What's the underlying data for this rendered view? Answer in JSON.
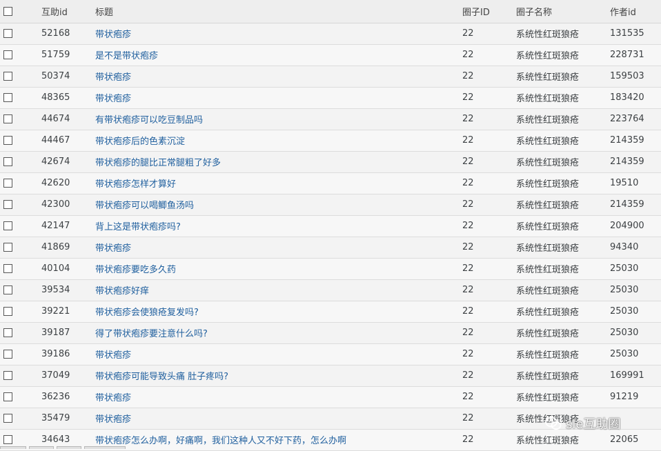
{
  "columns": {
    "id": "互助id",
    "title": "标题",
    "circle_id": "圈子ID",
    "circle_name": "圈子名称",
    "author_id": "作者id"
  },
  "rows": [
    {
      "id": "52168",
      "title": "带状疱疹",
      "circle_id": "22",
      "circle_name": "系统性红斑狼疮",
      "author_id": "131535"
    },
    {
      "id": "51759",
      "title": "是不是带状疱疹",
      "circle_id": "22",
      "circle_name": "系统性红斑狼疮",
      "author_id": "228731"
    },
    {
      "id": "50374",
      "title": "带状疱疹",
      "circle_id": "22",
      "circle_name": "系统性红斑狼疮",
      "author_id": "159503"
    },
    {
      "id": "48365",
      "title": "带状疱疹",
      "circle_id": "22",
      "circle_name": "系统性红斑狼疮",
      "author_id": "183420"
    },
    {
      "id": "44674",
      "title": "有带状疱疹可以吃豆制品吗",
      "circle_id": "22",
      "circle_name": "系统性红斑狼疮",
      "author_id": "223764"
    },
    {
      "id": "44467",
      "title": "带状疱疹后的色素沉淀",
      "circle_id": "22",
      "circle_name": "系统性红斑狼疮",
      "author_id": "214359"
    },
    {
      "id": "42674",
      "title": "带状疱疹的腿比正常腿粗了好多",
      "circle_id": "22",
      "circle_name": "系统性红斑狼疮",
      "author_id": "214359"
    },
    {
      "id": "42620",
      "title": "带状疱疹怎样才算好",
      "circle_id": "22",
      "circle_name": "系统性红斑狼疮",
      "author_id": "19510"
    },
    {
      "id": "42300",
      "title": "带状疱疹可以喝鲫鱼汤吗",
      "circle_id": "22",
      "circle_name": "系统性红斑狼疮",
      "author_id": "214359"
    },
    {
      "id": "42147",
      "title": "背上这是带状疱疹吗?",
      "circle_id": "22",
      "circle_name": "系统性红斑狼疮",
      "author_id": "204900"
    },
    {
      "id": "41869",
      "title": "带状疱疹",
      "circle_id": "22",
      "circle_name": "系统性红斑狼疮",
      "author_id": "94340"
    },
    {
      "id": "40104",
      "title": "带状疱疹要吃多久药",
      "circle_id": "22",
      "circle_name": "系统性红斑狼疮",
      "author_id": "25030"
    },
    {
      "id": "39534",
      "title": "带状疱疹好痒",
      "circle_id": "22",
      "circle_name": "系统性红斑狼疮",
      "author_id": "25030"
    },
    {
      "id": "39221",
      "title": "带状疱疹会使狼疮复发吗?",
      "circle_id": "22",
      "circle_name": "系统性红斑狼疮",
      "author_id": "25030"
    },
    {
      "id": "39187",
      "title": "得了带状疱疹要注意什么吗?",
      "circle_id": "22",
      "circle_name": "系统性红斑狼疮",
      "author_id": "25030"
    },
    {
      "id": "39186",
      "title": "带状疱疹",
      "circle_id": "22",
      "circle_name": "系统性红斑狼疮",
      "author_id": "25030"
    },
    {
      "id": "37049",
      "title": "带状疱疹可能导致头痛 肚子疼吗?",
      "circle_id": "22",
      "circle_name": "系统性红斑狼疮",
      "author_id": "169991"
    },
    {
      "id": "36236",
      "title": "带状疱疹",
      "circle_id": "22",
      "circle_name": "系统性红斑狼疮",
      "author_id": "91219"
    },
    {
      "id": "35479",
      "title": "带状疱疹",
      "circle_id": "22",
      "circle_name": "系统性红斑狼疮",
      "author_id": ""
    },
    {
      "id": "34643",
      "title": "带状疱疹怎么办啊，好痛啊，我们这种人又不好下药，怎么办啊",
      "circle_id": "22",
      "circle_name": "系统性红斑狼疮",
      "author_id": "22065"
    }
  ],
  "watermark": {
    "text": "sle互助圈",
    "icon": "wechat-icon"
  },
  "colors": {
    "link": "#1f5f9e",
    "header_bg": "#eeeeee",
    "row_bg": "#f3f3f3"
  }
}
